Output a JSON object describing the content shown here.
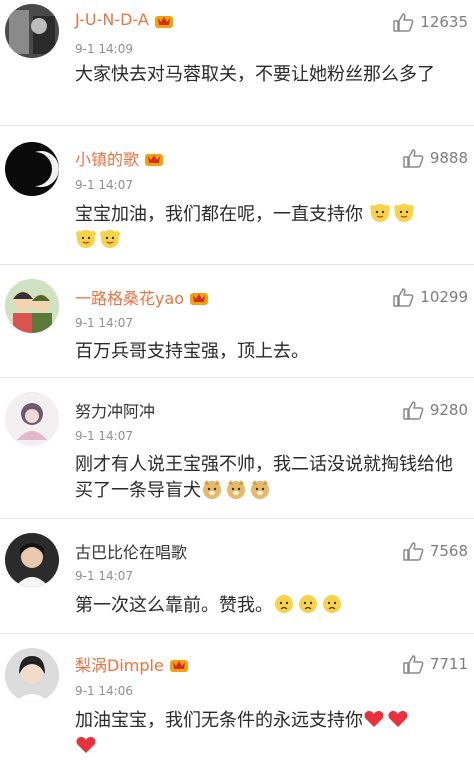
{
  "colors": {
    "username_vip": "#eb7340",
    "username_normal": "#333333",
    "timestamp": "#8f8f8f",
    "like": "#7d7d7d",
    "heart": "#e8313b"
  },
  "comments": [
    {
      "username": "J-U-N-D-A",
      "vip": true,
      "time": "9-1 14:09",
      "text": "大家快去对马蓉取关，不要让她粉丝那么多了",
      "likes": "12635",
      "emojis": []
    },
    {
      "username": "小镇的歌",
      "vip": true,
      "time": "9-1 14:07",
      "text": "宝宝加油，我们都在呢，一直支持你",
      "likes": "9888",
      "emojis": [
        "cute-face-icon",
        "cute-face-icon",
        "cute-face-icon",
        "cute-face-icon"
      ]
    },
    {
      "username": "一路格桑花yao",
      "vip": true,
      "time": "9-1 14:07",
      "text": "百万兵哥支持宝强，顶上去。",
      "likes": "10299",
      "emojis": []
    },
    {
      "username": "努力冲阿冲",
      "vip": false,
      "time": "9-1 14:07",
      "text": "刚才有人说王宝强不帅，我二话没说就掏钱给他买了一条导盲犬",
      "likes": "9280",
      "emojis": [
        "doge-icon",
        "doge-icon",
        "doge-icon"
      ]
    },
    {
      "username": "古巴比伦在唱歌",
      "vip": false,
      "time": "9-1 14:07",
      "text": "第一次这么靠前。赞我。",
      "likes": "7568",
      "emojis": [
        "sad-face-icon",
        "sad-face-icon",
        "sad-face-icon"
      ]
    },
    {
      "username": "梨涡Dimple",
      "vip": true,
      "time": "9-1 14:06",
      "text": "加油宝宝，我们无条件的永远支持你",
      "likes": "7711",
      "emojis": [
        "heart-icon",
        "heart-icon",
        "heart-icon"
      ]
    }
  ]
}
